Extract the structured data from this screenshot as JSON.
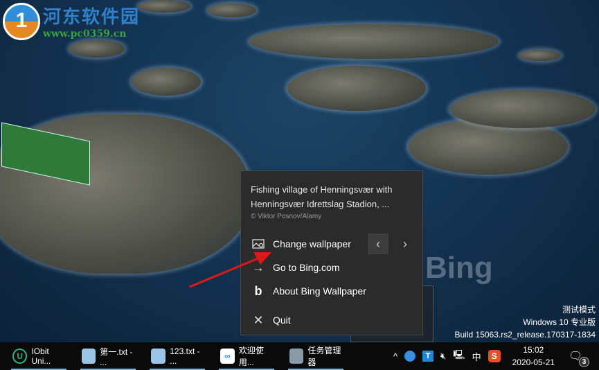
{
  "watermark": {
    "title": "河东软件园",
    "url": "www.pc0359.cn"
  },
  "popup": {
    "caption": "Fishing village of Henningsvær with Henningsvær Idrettslag Stadion, ...",
    "credit": "© Viktor Posnov/Alamy",
    "items": [
      {
        "label": "Change wallpaper",
        "icon": "image-icon"
      },
      {
        "label": "Go to Bing.com",
        "icon": "arrow-right-icon"
      },
      {
        "label": "About Bing Wallpaper",
        "icon": "bing-logo-icon"
      },
      {
        "label": "Quit",
        "icon": "close-icon"
      }
    ],
    "prev": "‹",
    "next": "›"
  },
  "ghost_text": "Bing",
  "sysinfo": {
    "line1": "测试模式",
    "line2": "Windows 10 专业版",
    "line3": "Build 15063.rs2_release.170317-1834"
  },
  "taskbar": {
    "apps": [
      {
        "label": "IObit Uni...",
        "icon": "iobit-icon"
      },
      {
        "label": "第一.txt - ...",
        "icon": "notepad-icon"
      },
      {
        "label": "123.txt - ...",
        "icon": "notepad-icon"
      },
      {
        "label": "欢迎使用...",
        "icon": "baidu-netdisk-icon"
      },
      {
        "label": "任务管理器",
        "icon": "task-manager-icon"
      }
    ],
    "tray": {
      "ime": "中",
      "time": "15:02",
      "date": "2020-05-21",
      "notifications": "3",
      "t_icon": "T",
      "sogou": "S"
    }
  }
}
